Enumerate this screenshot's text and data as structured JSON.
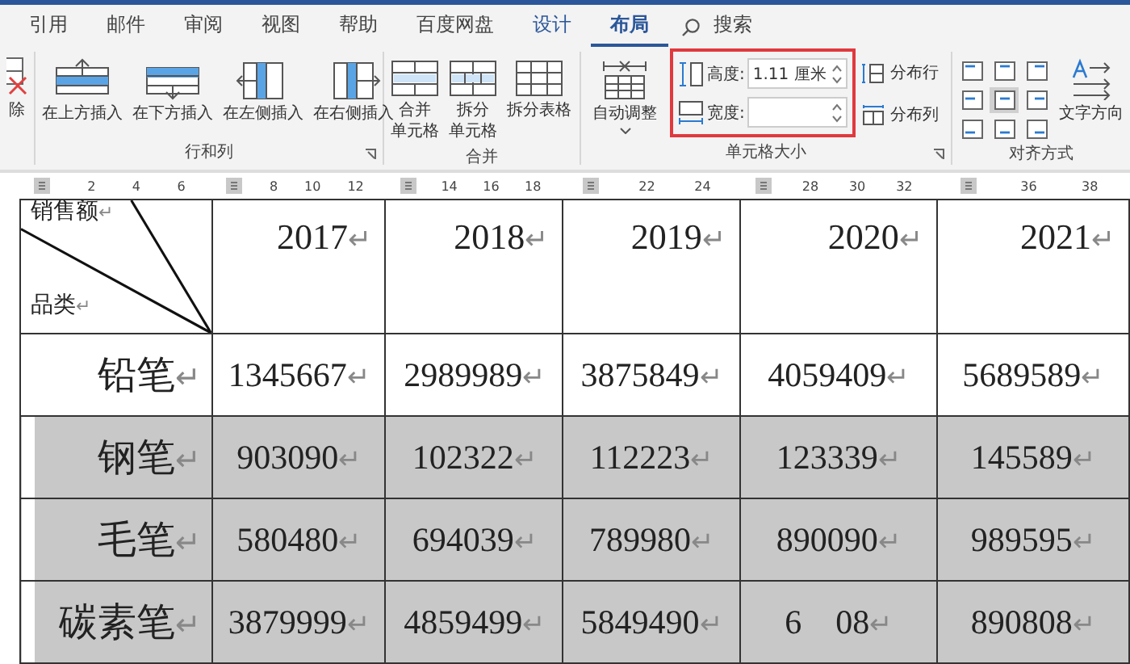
{
  "tabs": [
    {
      "label": "引用",
      "selected": false,
      "contextual": false
    },
    {
      "label": "邮件",
      "selected": false,
      "contextual": false
    },
    {
      "label": "审阅",
      "selected": false,
      "contextual": false
    },
    {
      "label": "视图",
      "selected": false,
      "contextual": false
    },
    {
      "label": "帮助",
      "selected": false,
      "contextual": false
    },
    {
      "label": "百度网盘",
      "selected": false,
      "contextual": false
    },
    {
      "label": "设计",
      "selected": false,
      "contextual": true
    },
    {
      "label": "布局",
      "selected": true,
      "contextual": true
    }
  ],
  "search": {
    "label": "搜索"
  },
  "ribbon": {
    "cut_button": {
      "label": "除"
    },
    "rows_group": {
      "label": "行和列",
      "buttons": [
        {
          "label": "在上方插入",
          "kind": "above"
        },
        {
          "label": "在下方插入",
          "kind": "below"
        },
        {
          "label": "在左侧插入",
          "kind": "left"
        },
        {
          "label": "在右侧插入",
          "kind": "right"
        }
      ]
    },
    "merge_group": {
      "label": "合并",
      "buttons": [
        {
          "lines": [
            "合并",
            "单元格"
          ],
          "kind": "merge"
        },
        {
          "lines": [
            "拆分",
            "单元格"
          ],
          "kind": "split"
        },
        {
          "lines": [
            "拆分表格"
          ],
          "kind": "table"
        }
      ]
    },
    "size_group": {
      "label": "单元格大小",
      "autofit": {
        "label": "自动调整"
      },
      "height": {
        "label": "高度:",
        "value": "1.11 厘米"
      },
      "width": {
        "label": "宽度:"
      },
      "distribute_rows": {
        "label": "分布行"
      },
      "distribute_cols": {
        "label": "分布列"
      },
      "highlighted": true
    },
    "align_group": {
      "label": "对齐方式",
      "cells": [
        {
          "selected": false
        },
        {
          "selected": false
        },
        {
          "selected": false
        },
        {
          "selected": false
        },
        {
          "selected": true
        },
        {
          "selected": false
        },
        {
          "selected": false
        },
        {
          "selected": false
        },
        {
          "selected": false
        }
      ],
      "text_direction": {
        "label": "文字方向"
      }
    }
  },
  "ruler": [
    {
      "numbers": [
        "2",
        "4",
        "6"
      ]
    },
    {
      "numbers": [
        "8",
        "10",
        "12"
      ]
    },
    {
      "numbers": [
        "14",
        "16",
        "18"
      ]
    },
    {
      "numbers": [
        "22",
        "24"
      ]
    },
    {
      "numbers": [
        "28",
        "30",
        "32"
      ]
    },
    {
      "numbers": [
        "36",
        "38"
      ]
    }
  ],
  "table": {
    "header": {
      "corner_top": "销售额↵",
      "corner_bottom": "品类↵",
      "years": [
        "2017↵",
        "2018↵",
        "2019↵",
        "2020↵",
        "2021↵"
      ]
    },
    "rows": [
      {
        "name": "铅笔↵",
        "selected": false,
        "cells": [
          "1345667↵",
          "2989989↵",
          "3875849↵",
          "4059409↵",
          "5689589↵"
        ]
      },
      {
        "name": "钢笔↵",
        "selected": true,
        "cells": [
          "903090↵",
          "102322↵",
          "112223↵",
          "123339↵",
          "145589↵"
        ]
      },
      {
        "name": "毛笔↵",
        "selected": true,
        "cells": [
          "580480↵",
          "694039↵",
          "789980↵",
          "890090↵",
          "989595↵"
        ]
      },
      {
        "name": "碳素笔↵",
        "selected": true,
        "cells": [
          "3879999↵",
          "4859499↵",
          "5849490↵",
          "6    08↵",
          "890808↵"
        ]
      }
    ]
  }
}
